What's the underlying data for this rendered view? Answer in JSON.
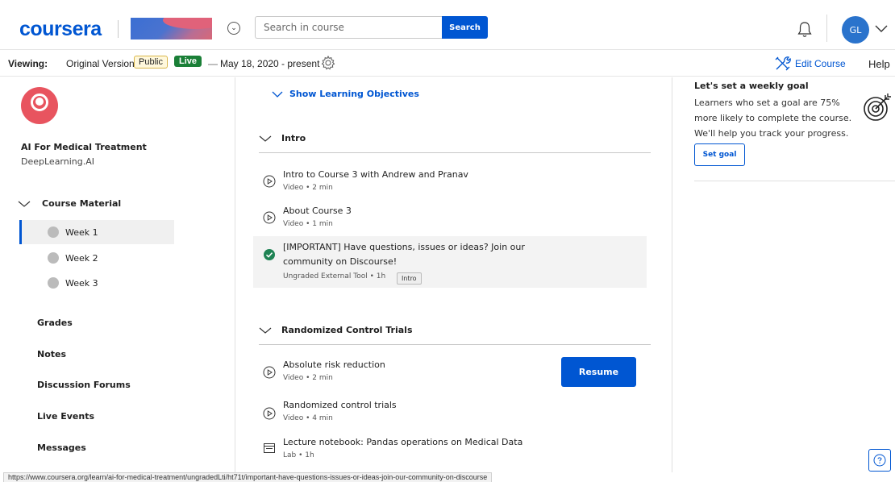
{
  "header": {
    "logo": "coursera",
    "search_placeholder": "Search in course",
    "search_label": "Search",
    "avatar_initials": "GL"
  },
  "viewbar": {
    "viewing_label": "Viewing:",
    "version": "Original Version",
    "public_badge": "Public",
    "live_badge": "Live",
    "dash": "—",
    "date_range": "May 18, 2020 - present",
    "edit_course": "Edit Course",
    "help": "Help"
  },
  "sidebar": {
    "course_title": "AI For Medical Treatment",
    "course_org": "DeepLearning.AI",
    "course_material": "Course Material",
    "weeks": [
      "Week 1",
      "Week 2",
      "Week 3"
    ],
    "active_week": "Week 1",
    "nav": [
      "Grades",
      "Notes",
      "Discussion Forums",
      "Live Events",
      "Messages"
    ]
  },
  "main": {
    "show_objectives": "Show Learning Objectives",
    "sections": [
      {
        "title": "Intro",
        "items": [
          {
            "title": "Intro to Course 3 with Andrew and Pranav",
            "meta": "Video • 2 min",
            "icon": "play-circle-icon"
          },
          {
            "title": "About Course 3",
            "meta": "Video • 1 min",
            "icon": "play-circle-icon"
          },
          {
            "title": "[IMPORTANT] Have questions, issues or ideas? Join our community on Discourse!",
            "meta": "Ungraded External Tool • 1h",
            "icon": "check-circle-icon",
            "tooltip": "Intro",
            "completed": true
          }
        ]
      },
      {
        "title": "Randomized Control Trials",
        "items": [
          {
            "title": "Absolute risk reduction",
            "meta": "Video • 2 min",
            "icon": "play-circle-icon"
          },
          {
            "title": "Randomized control trials",
            "meta": "Video • 4 min",
            "icon": "play-circle-icon"
          },
          {
            "title": "Lecture notebook: Pandas operations on Medical Data",
            "meta": "Lab • 1h",
            "icon": "lab-window-icon"
          }
        ]
      }
    ],
    "resume_label": "Resume"
  },
  "goal": {
    "title": "Let's set a weekly goal",
    "text": "Learners who set a goal are 75% more likely to complete the course. We'll help you track your progress.",
    "button": "Set goal"
  },
  "status_url": "https://www.coursera.org/learn/ai-for-medical-treatment/ungradedLti/ht71t/important-have-questions-issues-or-ideas-join-our-community-on-discourse",
  "colors": {
    "accent": "#0056d2",
    "live": "#1a7f37",
    "logo_red": "#e8545f",
    "check": "#1f8354"
  }
}
